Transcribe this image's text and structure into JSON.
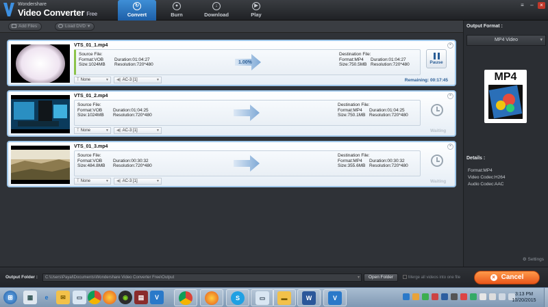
{
  "app": {
    "brand_small": "Wondershare",
    "brand_big": "Video Converter",
    "brand_suffix": "Free"
  },
  "tabs": [
    {
      "label": "Convert",
      "active": true
    },
    {
      "label": "Burn",
      "active": false
    },
    {
      "label": "Download",
      "active": false
    },
    {
      "label": "Play",
      "active": false
    }
  ],
  "toolbar": {
    "add_files": "Add Files",
    "load_dvd": "Load DVD"
  },
  "files": [
    {
      "name": "VTS_01_1.mp4",
      "source": {
        "heading": "Source File:",
        "format": "Format:VOB",
        "size": "Size:1024MB",
        "duration": "Duration:01:04:27",
        "resolution": "Resolution:720*480"
      },
      "dest": {
        "heading": "Destination File:",
        "format": "Format:MP4",
        "size": "Size:750.5MB",
        "duration": "Duration:01:04:27",
        "resolution": "Resolution:720*480"
      },
      "subtitle": "None",
      "audio": "AC-3 [1]",
      "progress": "1.00%",
      "action": "Pause",
      "status": "Remaining: 00:17:45"
    },
    {
      "name": "VTS_01_2.mp4",
      "source": {
        "heading": "Source File:",
        "format": "Format:VOB",
        "size": "Size:1024MB",
        "duration": "Duration:01:04:25",
        "resolution": "Resolution:720*480"
      },
      "dest": {
        "heading": "Destination File:",
        "format": "Format:MP4",
        "size": "Size:750.1MB",
        "duration": "Duration:01:04:25",
        "resolution": "Resolution:720*480"
      },
      "subtitle": "None",
      "audio": "AC-3 [1]",
      "status": "Waiting"
    },
    {
      "name": "VTS_01_3.mp4",
      "source": {
        "heading": "Source File:",
        "format": "Format:VOB",
        "size": "Size:484.8MB",
        "duration": "Duration:00:30:32",
        "resolution": "Resolution:720*480"
      },
      "dest": {
        "heading": "Destination File:",
        "format": "Format:MP4",
        "size": "Size:355.6MB",
        "duration": "Duration:00:30:32",
        "resolution": "Resolution:720*480"
      },
      "subtitle": "None",
      "audio": "AC-3 [1]",
      "status": "Waiting"
    }
  ],
  "panel": {
    "output_format_label": "Output Format :",
    "format_value": "MP4 Video",
    "icon_text": "MP4",
    "details_label": "Details :",
    "details": [
      "Format:MP4",
      "Video Codec:H264",
      "Audio Codec:AAC"
    ],
    "settings": "Settings"
  },
  "bottom": {
    "output_folder_label": "Output Folder :",
    "output_folder_path": "C:\\Users\\Payal\\Documents\\Wondershare Video Converter Free\\Output",
    "open_folder": "Open Folder",
    "merge": "Merge all videos into one file",
    "cancel": "Cancel"
  },
  "taskbar": {
    "time": "3:13 PM",
    "date": "10/20/2015"
  },
  "colors": {
    "accent": "#1d5fa8",
    "cancel": "#e8561a",
    "selected_border": "#9fc7ea"
  }
}
